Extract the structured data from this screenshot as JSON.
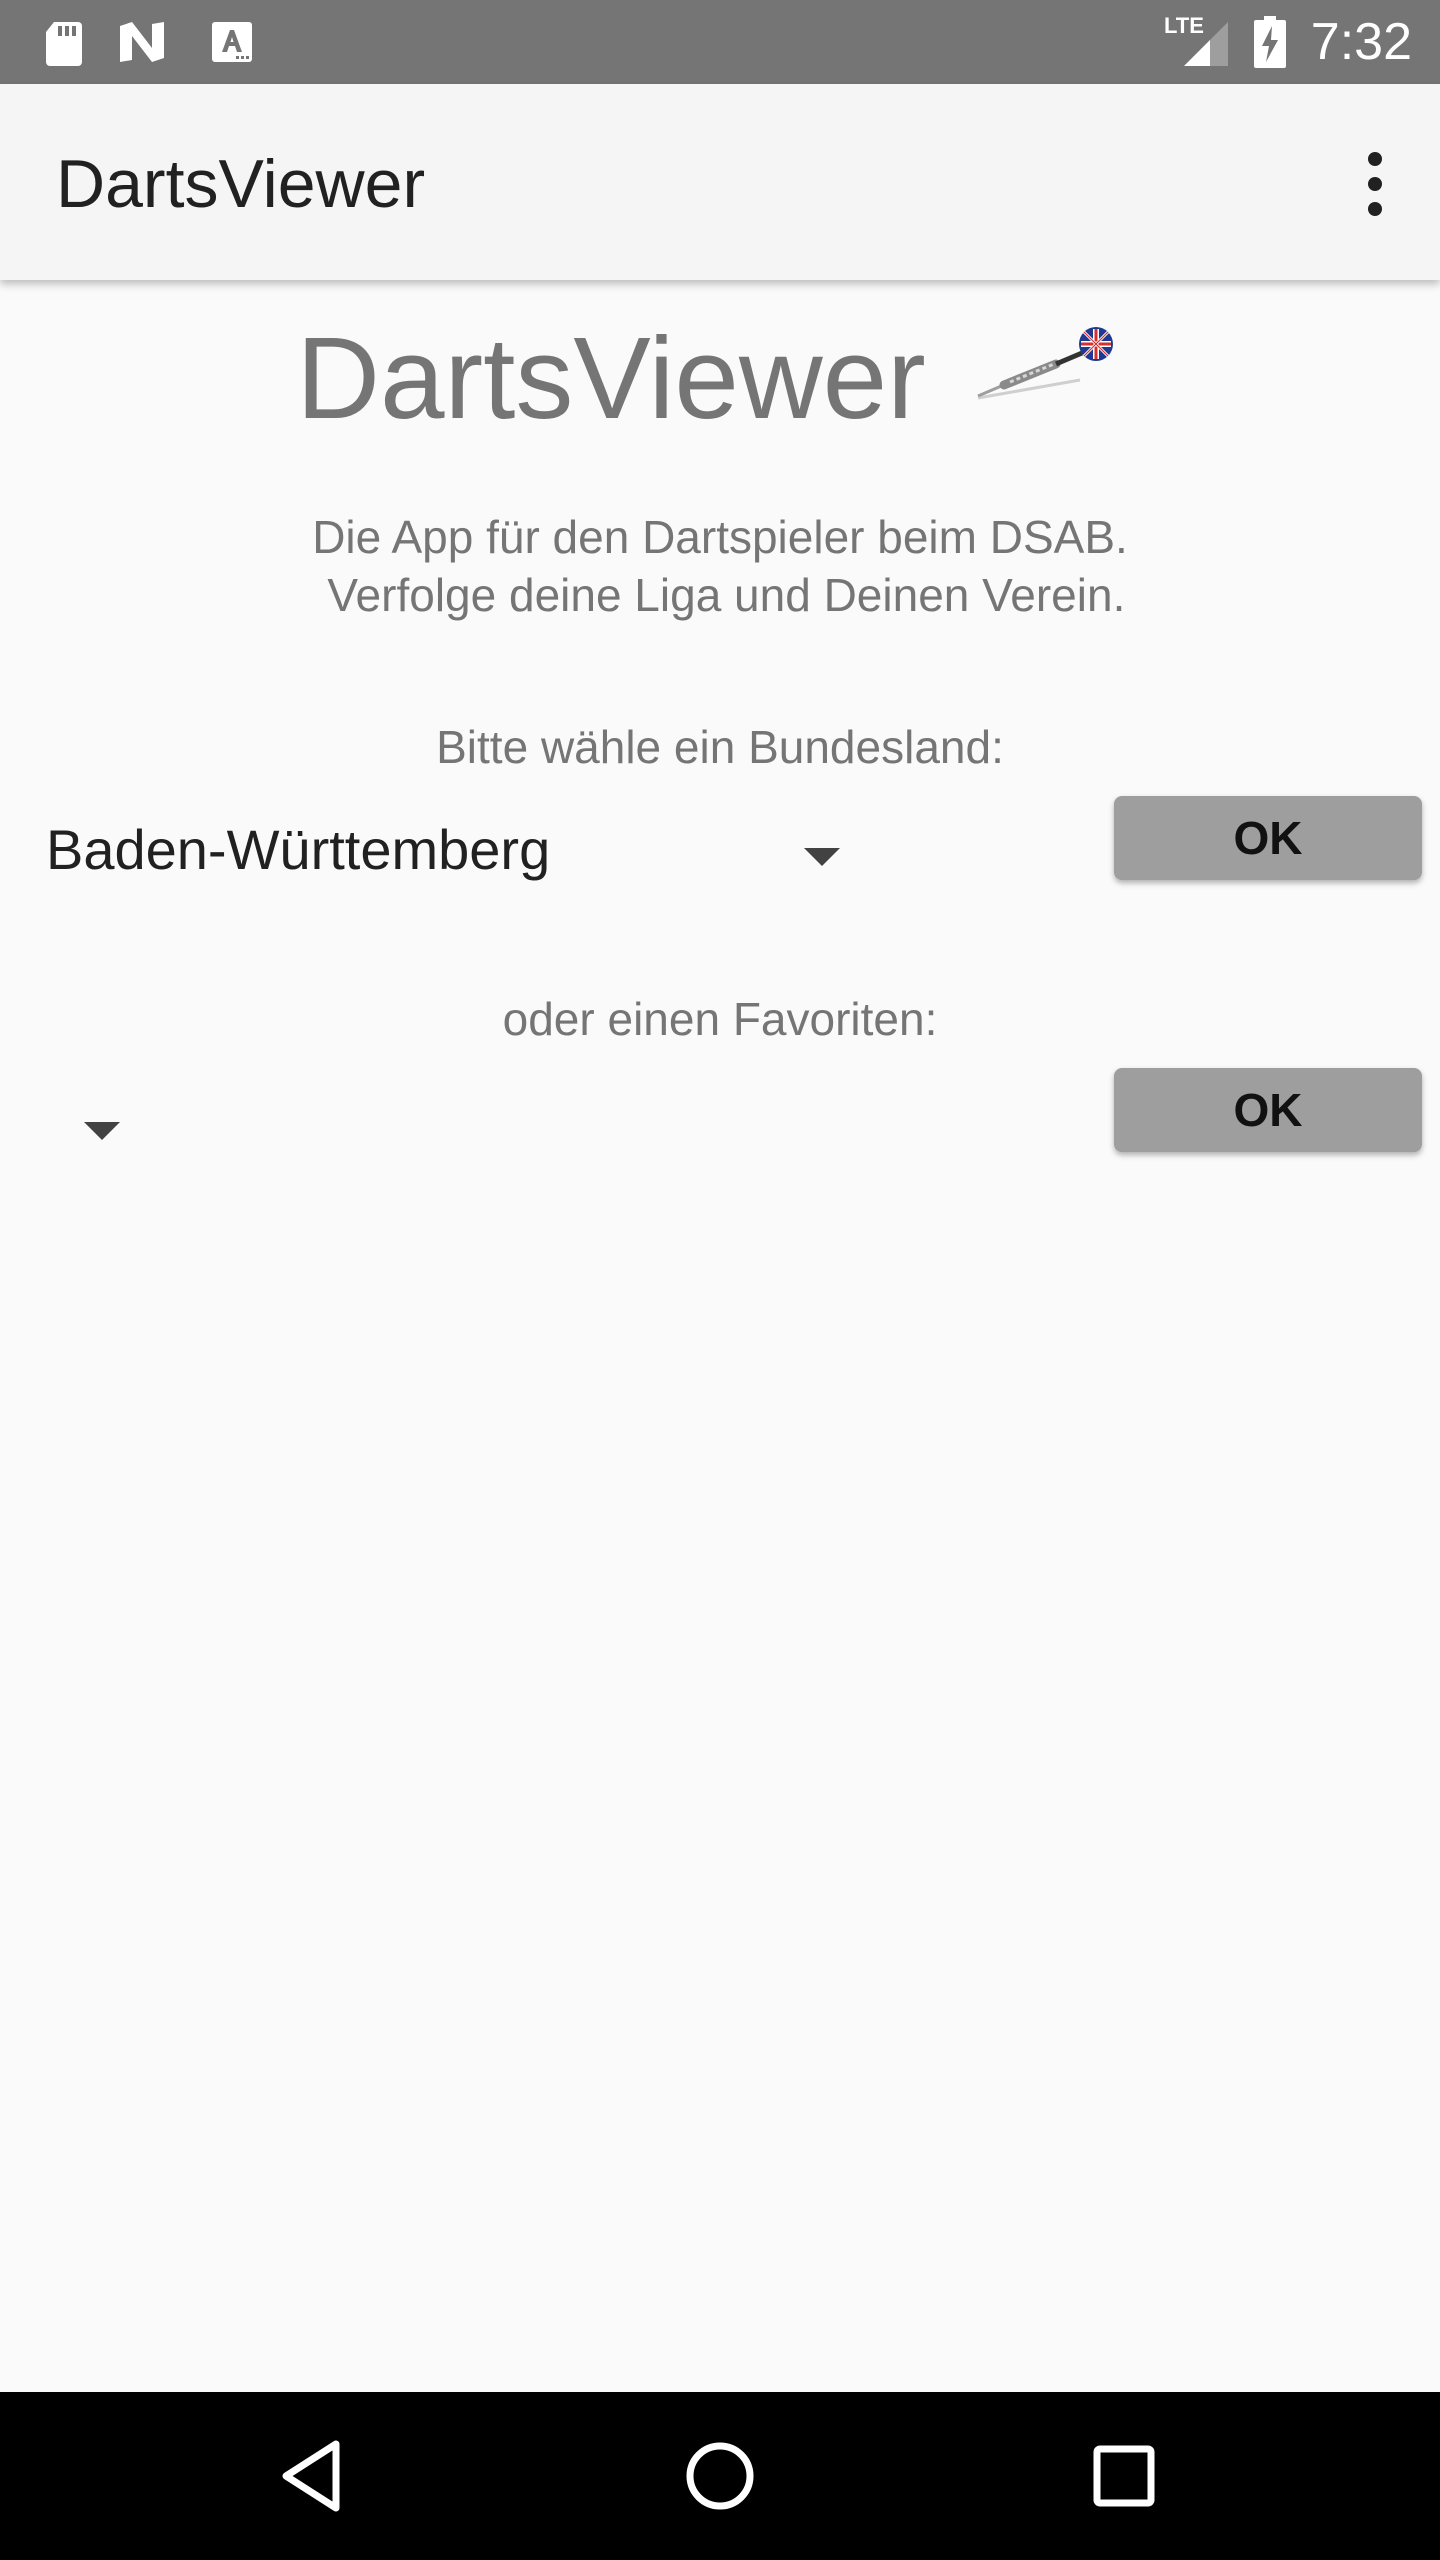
{
  "status_bar": {
    "time": "7:32",
    "left_icons": [
      "sd-card-icon",
      "n-notification-icon",
      "text-a-icon"
    ],
    "right_icons": [
      "lte-signal-icon",
      "battery-charging-icon"
    ],
    "network_label": "LTE"
  },
  "app_bar": {
    "title": "DartsViewer",
    "overflow_icon": "more-vert-icon"
  },
  "main": {
    "hero_title": "DartsViewer",
    "logo_icon": "dart-icon",
    "intro_line_1": "Die App für den Dartspieler beim DSAB.",
    "intro_line_2": " Verfolge deine Liga und Deinen Verein.",
    "state_label": "Bitte wähle ein Bundesland:",
    "state_selected": "Baden-Württemberg",
    "state_ok_label": "OK",
    "favorite_label": "oder einen Favoriten:",
    "favorite_selected": "",
    "favorite_ok_label": "OK"
  },
  "nav_bar": {
    "icons": [
      "back-triangle-icon",
      "home-circle-icon",
      "recents-square-icon"
    ]
  },
  "colors": {
    "status_bar_bg": "#757575",
    "app_bar_bg": "#f5f5f5",
    "background": "#fafafa",
    "button_bg": "#9e9e9e",
    "nav_bar_bg": "#000000",
    "secondary_text": "#757575"
  }
}
